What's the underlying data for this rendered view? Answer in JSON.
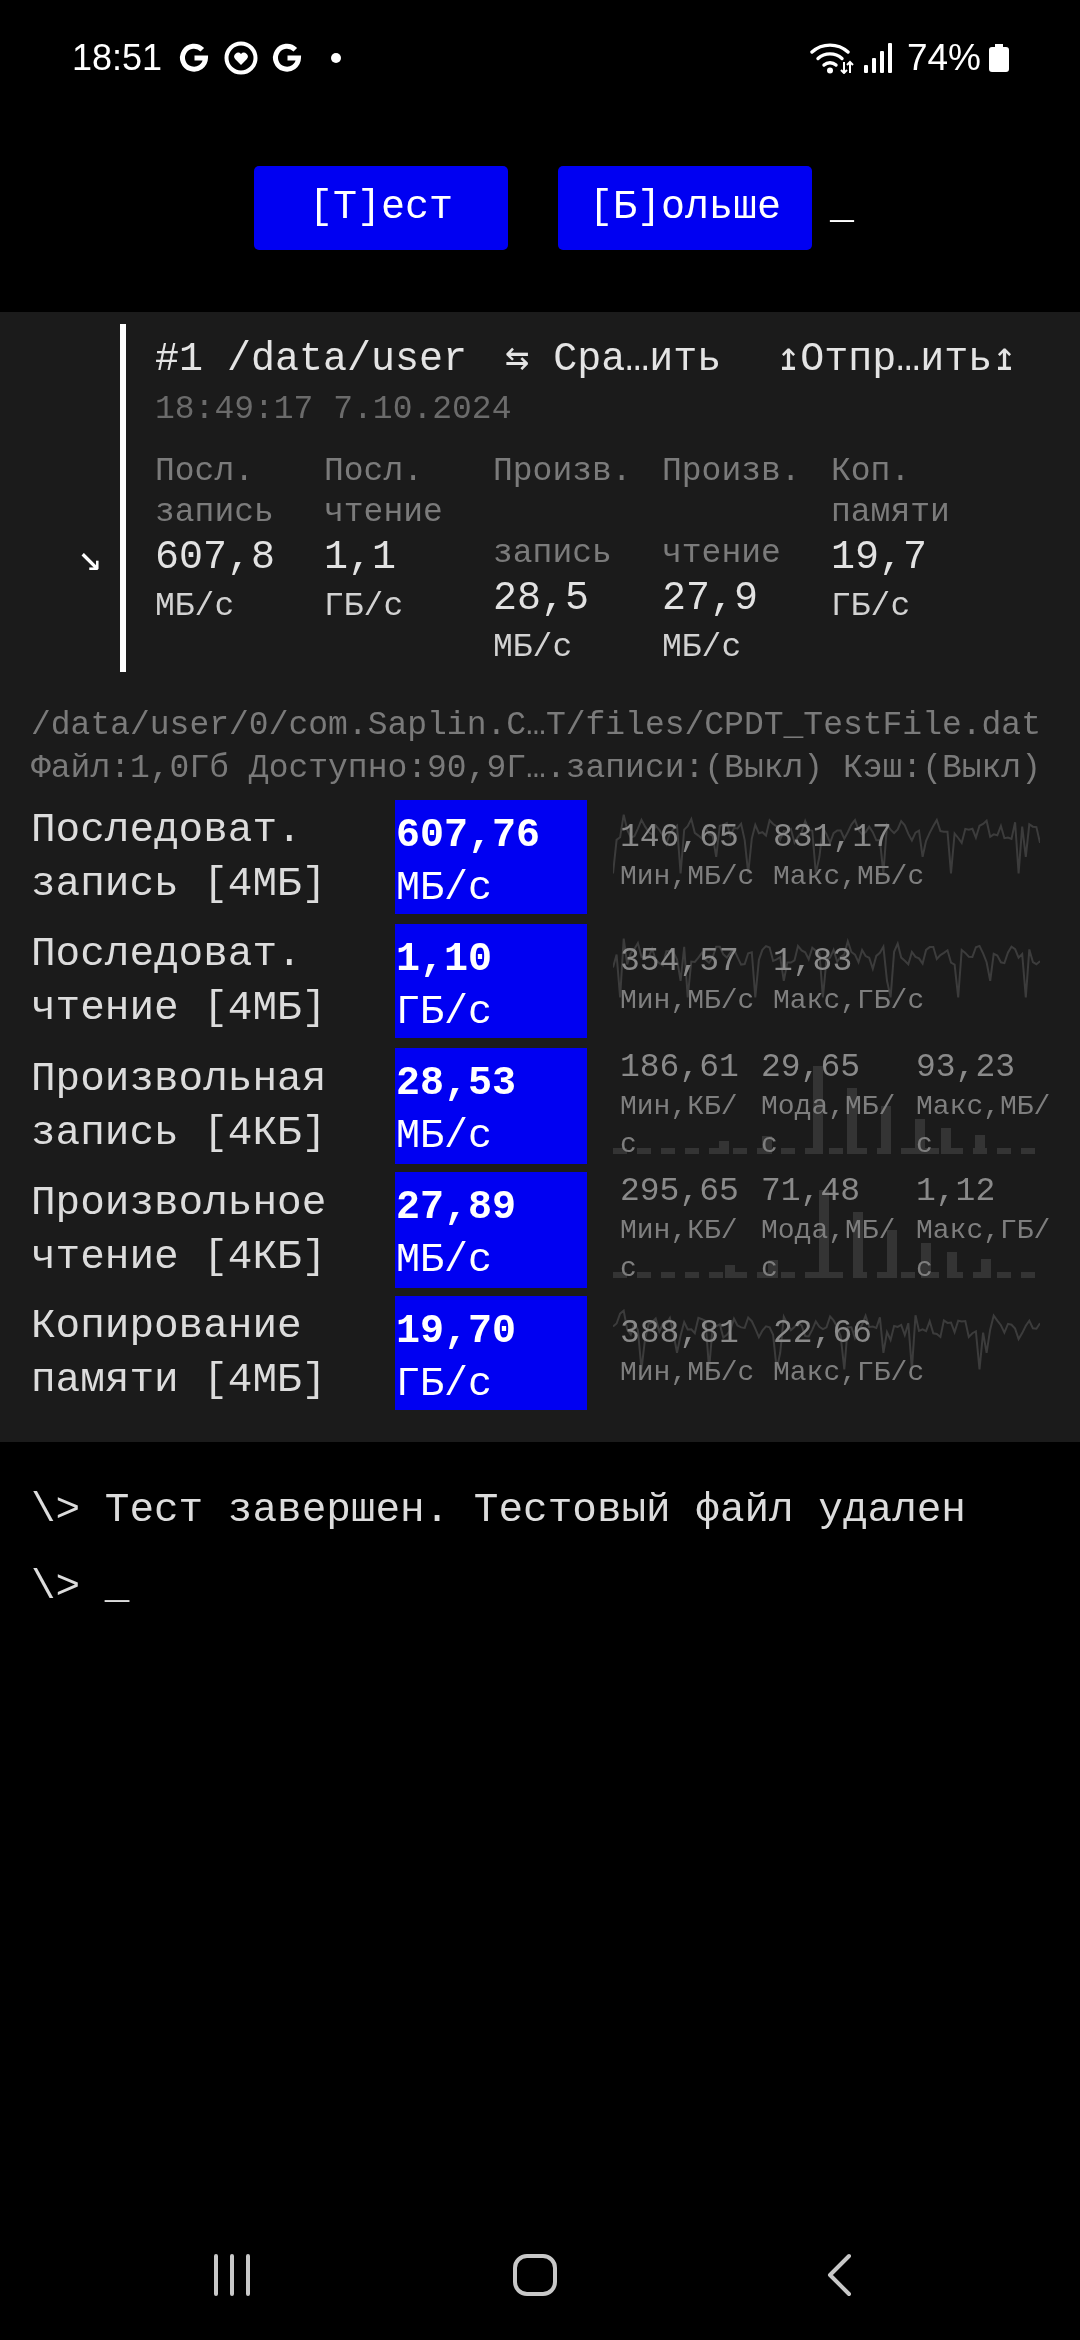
{
  "status_bar": {
    "time": "18:51",
    "battery": "74%"
  },
  "action_bar": {
    "buttons": [
      "[Т]ест",
      "[Б]ольше"
    ],
    "cursor": "_"
  },
  "history": [
    {
      "toggle": "↘",
      "title": "#1 /data/user",
      "compare": "⇆ Сра…ить",
      "share": "↥Отпр…ить↥",
      "timestamp": "18:49:17 7.10.2024",
      "columns": [
        {
          "label": "Посл.\nзапись",
          "value": "607,8",
          "unit": "МБ/с"
        },
        {
          "label": "Посл.\nчтение",
          "value": "1,1",
          "unit": "ГБ/с"
        },
        {
          "label": "Произв.\n\nзапись",
          "value": "28,5",
          "unit": "МБ/с"
        },
        {
          "label": "Произв.\n\nчтение",
          "value": "27,9",
          "unit": "МБ/с"
        },
        {
          "label": "Коп.\nпамяти",
          "value": "19,7",
          "unit": "ГБ/с"
        }
      ]
    }
  ],
  "test_info": {
    "path": "/data/user/0/com.Saplin.C…T/files/CPDT_TestFile.dat",
    "details": "Файл:1,0Гб Доступно:90,9Г….записи:(Выкл) Кэш:(Выкл)"
  },
  "results": [
    {
      "kind": "line",
      "label": "Последоват. запись [4МБ]",
      "value": "607,76",
      "unit": "МБ/с",
      "stats": [
        {
          "value": "146,65",
          "label": "Мин,МБ/с"
        },
        {
          "value": "831,17",
          "label": "Макс,МБ/с"
        }
      ]
    },
    {
      "kind": "line",
      "label": "Последоват. чтение [4МБ]",
      "value": "1,10",
      "unit": "ГБ/с",
      "stats": [
        {
          "value": "354,57",
          "label": "Мин,МБ/с"
        },
        {
          "value": "1,83",
          "label": "Макс,ГБ/с"
        }
      ]
    },
    {
      "kind": "histogram",
      "label": "Произвольная запись [4КБ]",
      "value": "28,53",
      "unit": "МБ/с",
      "stats": [
        {
          "value": "186,61",
          "label": "Мин,КБ/с"
        },
        {
          "value": "29,65",
          "label": "Мода,МБ/с"
        },
        {
          "value": "93,23",
          "label": "Макс,МБ/с"
        }
      ]
    },
    {
      "kind": "histogram",
      "label": "Произвольное чтение [4КБ]",
      "value": "27,89",
      "unit": "МБ/с",
      "stats": [
        {
          "value": "295,65",
          "label": "Мин,КБ/с"
        },
        {
          "value": "71,48",
          "label": "Мода,МБ/с"
        },
        {
          "value": "1,12",
          "label": "Макс,ГБ/с"
        }
      ]
    },
    {
      "kind": "line",
      "label": "Копирование памяти [4МБ]",
      "value": "19,70",
      "unit": "ГБ/с",
      "stats": [
        {
          "value": "388,81",
          "label": "Мин,МБ/с"
        },
        {
          "value": "22,66",
          "label": "Макс,ГБ/с"
        }
      ]
    }
  ],
  "console": {
    "lines": [
      "\\> Тест завершен. Тестовый файл удален",
      "\\> _"
    ]
  }
}
